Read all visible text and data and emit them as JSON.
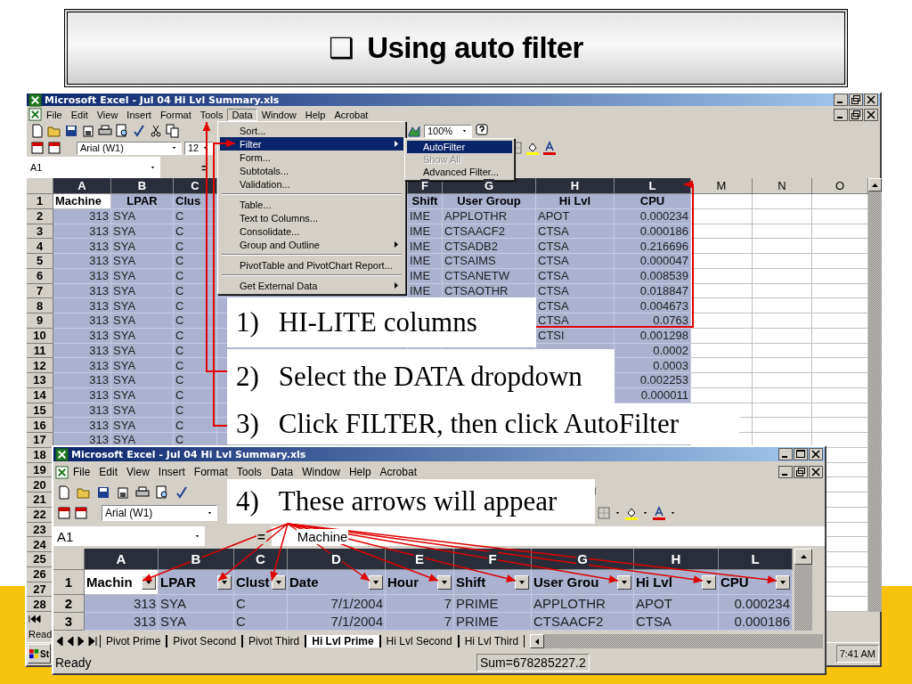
{
  "slide": {
    "bullet": "❑",
    "title": "Using auto filter"
  },
  "back_window": {
    "title": "Microsoft Excel - Jul 04 Hi Lvl Summary.xls",
    "menu": [
      {
        "label": "File",
        "selected": false
      },
      {
        "label": "Edit",
        "selected": false
      },
      {
        "label": "View",
        "selected": false
      },
      {
        "label": "Insert",
        "selected": false
      },
      {
        "label": "Format",
        "selected": false
      },
      {
        "label": "Tools",
        "selected": false
      },
      {
        "label": "Data",
        "selected": true
      },
      {
        "label": "Window",
        "selected": false
      },
      {
        "label": "Help",
        "selected": false
      },
      {
        "label": "Acrobat",
        "selected": false
      }
    ],
    "font": "Arial (W1)",
    "font_size": "12",
    "zoom": "100%",
    "name_box": "A1",
    "formula_sign": "=",
    "columns": [
      {
        "label": "A",
        "selected": true
      },
      {
        "label": "B",
        "selected": true
      },
      {
        "label": "C",
        "selected": true
      },
      {
        "label": "F",
        "selected": true
      },
      {
        "label": "G",
        "selected": true
      },
      {
        "label": "H",
        "selected": true
      },
      {
        "label": "L",
        "selected": true
      },
      {
        "label": "M",
        "selected": false
      },
      {
        "label": "N",
        "selected": false
      },
      {
        "label": "O",
        "selected": false
      }
    ],
    "rows": [
      {
        "num": "1",
        "cells": [
          {
            "kind": "active",
            "text": "Machine"
          },
          {
            "kind": "header",
            "text": "LPAR"
          },
          {
            "kind": "label",
            "text": "Clus"
          },
          {
            "kind": "header",
            "text": "Shift"
          },
          {
            "kind": "header",
            "text": "User Group"
          },
          {
            "kind": "header",
            "text": "Hi Lvl"
          },
          {
            "kind": "header",
            "text": "CPU"
          }
        ]
      },
      {
        "num": "2",
        "cells": [
          {
            "kind": "number",
            "text": "313"
          },
          {
            "kind": "text",
            "text": "SYA"
          },
          {
            "kind": "text",
            "text": "C"
          },
          {
            "kind": "text",
            "text": "IME"
          },
          {
            "kind": "text",
            "text": "APPLOTHR"
          },
          {
            "kind": "text",
            "text": "APOT"
          },
          {
            "kind": "number",
            "text": "0.000234"
          }
        ]
      },
      {
        "num": "3",
        "cells": [
          {
            "kind": "number",
            "text": "313"
          },
          {
            "kind": "text",
            "text": "SYA"
          },
          {
            "kind": "text",
            "text": "C"
          },
          {
            "kind": "text",
            "text": "IME"
          },
          {
            "kind": "text",
            "text": "CTSAACF2"
          },
          {
            "kind": "text",
            "text": "CTSA"
          },
          {
            "kind": "number",
            "text": "0.000186"
          }
        ]
      },
      {
        "num": "4",
        "cells": [
          {
            "kind": "number",
            "text": "313"
          },
          {
            "kind": "text",
            "text": "SYA"
          },
          {
            "kind": "text",
            "text": "C"
          },
          {
            "kind": "text",
            "text": "IME"
          },
          {
            "kind": "text",
            "text": "CTSADB2"
          },
          {
            "kind": "text",
            "text": "CTSA"
          },
          {
            "kind": "number",
            "text": "0.216696"
          }
        ]
      },
      {
        "num": "5",
        "cells": [
          {
            "kind": "number",
            "text": "313"
          },
          {
            "kind": "text",
            "text": "SYA"
          },
          {
            "kind": "text",
            "text": "C"
          },
          {
            "kind": "text",
            "text": "IME"
          },
          {
            "kind": "text",
            "text": "CTSAIMS"
          },
          {
            "kind": "text",
            "text": "CTSA"
          },
          {
            "kind": "number",
            "text": "0.000047"
          }
        ]
      },
      {
        "num": "6",
        "cells": [
          {
            "kind": "number",
            "text": "313"
          },
          {
            "kind": "text",
            "text": "SYA"
          },
          {
            "kind": "text",
            "text": "C"
          },
          {
            "kind": "text",
            "text": "IME"
          },
          {
            "kind": "text",
            "text": "CTSANETW"
          },
          {
            "kind": "text",
            "text": "CTSA"
          },
          {
            "kind": "number",
            "text": "0.008539"
          }
        ]
      },
      {
        "num": "7",
        "cells": [
          {
            "kind": "number",
            "text": "313"
          },
          {
            "kind": "text",
            "text": "SYA"
          },
          {
            "kind": "text",
            "text": "C"
          },
          {
            "kind": "text",
            "text": "IME"
          },
          {
            "kind": "text",
            "text": "CTSAOTHR"
          },
          {
            "kind": "text",
            "text": "CTSA"
          },
          {
            "kind": "number",
            "text": "0.018847"
          }
        ]
      },
      {
        "num": "8",
        "cells": [
          {
            "kind": "number",
            "text": "313"
          },
          {
            "kind": "text",
            "text": "SYA"
          },
          {
            "kind": "text",
            "text": "C"
          },
          {
            "kind": "blank"
          },
          {
            "kind": "blank"
          },
          {
            "kind": "text",
            "text": "CTSA"
          },
          {
            "kind": "number",
            "text": "0.004673"
          }
        ]
      },
      {
        "num": "9",
        "cells": [
          {
            "kind": "number",
            "text": "313"
          },
          {
            "kind": "text",
            "text": "SYA"
          },
          {
            "kind": "text",
            "text": "C"
          },
          {
            "kind": "blank"
          },
          {
            "kind": "blank"
          },
          {
            "kind": "text",
            "text": "CTSA"
          },
          {
            "kind": "number",
            "text": "0.0763"
          }
        ]
      },
      {
        "num": "10",
        "cells": [
          {
            "kind": "number",
            "text": "313"
          },
          {
            "kind": "text",
            "text": "SYA"
          },
          {
            "kind": "text",
            "text": "C"
          },
          {
            "kind": "blank"
          },
          {
            "kind": "blank"
          },
          {
            "kind": "text",
            "text": "CTSI"
          },
          {
            "kind": "number",
            "text": "0.001298"
          }
        ]
      },
      {
        "num": "11",
        "cells": [
          {
            "kind": "number",
            "text": "313"
          },
          {
            "kind": "text",
            "text": "SYA"
          },
          {
            "kind": "text",
            "text": "C"
          },
          {
            "kind": "blank"
          },
          {
            "kind": "blank"
          },
          {
            "kind": "blank"
          },
          {
            "kind": "number",
            "text": "0.0002"
          }
        ]
      },
      {
        "num": "12",
        "cells": [
          {
            "kind": "number",
            "text": "313"
          },
          {
            "kind": "text",
            "text": "SYA"
          },
          {
            "kind": "text",
            "text": "C"
          },
          {
            "kind": "blank"
          },
          {
            "kind": "blank"
          },
          {
            "kind": "blank"
          },
          {
            "kind": "number",
            "text": "0.0003"
          }
        ]
      },
      {
        "num": "13",
        "cells": [
          {
            "kind": "number",
            "text": "313"
          },
          {
            "kind": "text",
            "text": "SYA"
          },
          {
            "kind": "text",
            "text": "C"
          },
          {
            "kind": "blank"
          },
          {
            "kind": "blank"
          },
          {
            "kind": "blank"
          },
          {
            "kind": "number",
            "text": "0.002253"
          }
        ]
      },
      {
        "num": "14",
        "cells": [
          {
            "kind": "number",
            "text": "313"
          },
          {
            "kind": "text",
            "text": "SYA"
          },
          {
            "kind": "text",
            "text": "C"
          },
          {
            "kind": "blank"
          },
          {
            "kind": "blank"
          },
          {
            "kind": "blank"
          },
          {
            "kind": "number",
            "text": "0.000011"
          }
        ]
      },
      {
        "num": "15",
        "cells": [
          {
            "kind": "number",
            "text": "313"
          },
          {
            "kind": "text",
            "text": "SYA"
          },
          {
            "kind": "text",
            "text": "C"
          },
          {
            "kind": "blank"
          },
          {
            "kind": "blank"
          },
          {
            "kind": "blank"
          },
          {
            "kind": "blank"
          }
        ]
      },
      {
        "num": "16",
        "cells": [
          {
            "kind": "number",
            "text": "313"
          },
          {
            "kind": "text",
            "text": "SYA"
          },
          {
            "kind": "text",
            "text": "C"
          },
          {
            "kind": "blank"
          },
          {
            "kind": "blank"
          },
          {
            "kind": "blank"
          },
          {
            "kind": "blank"
          }
        ]
      },
      {
        "num": "17",
        "cells": [
          {
            "kind": "number",
            "text": "313"
          },
          {
            "kind": "text",
            "text": "SYA"
          },
          {
            "kind": "text",
            "text": "C"
          },
          {
            "kind": "blank"
          },
          {
            "kind": "blank"
          },
          {
            "kind": "blank"
          },
          {
            "kind": "blank"
          }
        ]
      },
      {
        "num": "18"
      },
      {
        "num": "19"
      },
      {
        "num": "20"
      },
      {
        "num": "21"
      },
      {
        "num": "22"
      },
      {
        "num": "23"
      },
      {
        "num": "24"
      },
      {
        "num": "25"
      },
      {
        "num": "26"
      },
      {
        "num": "27"
      },
      {
        "num": "28"
      }
    ],
    "status": "Read",
    "start": "St",
    "clock": "7:41 AM"
  },
  "data_menu": {
    "items": [
      {
        "kind": "item",
        "label": "Sort...",
        "selected": false,
        "submenu": false
      },
      {
        "kind": "item",
        "label": "Filter",
        "selected": true,
        "submenu": true
      },
      {
        "kind": "item",
        "label": "Form...",
        "selected": false,
        "submenu": false
      },
      {
        "kind": "item",
        "label": "Subtotals...",
        "selected": false,
        "submenu": false
      },
      {
        "kind": "item",
        "label": "Validation...",
        "selected": false,
        "submenu": false
      },
      {
        "kind": "separator"
      },
      {
        "kind": "item",
        "label": "Table...",
        "selected": false,
        "submenu": false
      },
      {
        "kind": "item",
        "label": "Text to Columns...",
        "selected": false,
        "submenu": false
      },
      {
        "kind": "item",
        "label": "Consolidate...",
        "selected": false,
        "submenu": false
      },
      {
        "kind": "item",
        "label": "Group and Outline",
        "selected": false,
        "submenu": true
      },
      {
        "kind": "separator"
      },
      {
        "kind": "item",
        "label": "PivotTable and PivotChart Report...",
        "selected": false,
        "submenu": false
      },
      {
        "kind": "separator"
      },
      {
        "kind": "item",
        "label": "Get External Data",
        "selected": false,
        "submenu": true
      }
    ]
  },
  "filter_submenu": {
    "items": [
      {
        "label": "AutoFilter",
        "selected": true,
        "disabled": false
      },
      {
        "label": "Show All",
        "selected": false,
        "disabled": true
      },
      {
        "label": "Advanced Filter...",
        "selected": false,
        "disabled": false
      }
    ]
  },
  "callouts": [
    {
      "num": "1)",
      "text": "HI-LITE columns"
    },
    {
      "num": "2)",
      "text": "Select the DATA dropdown"
    },
    {
      "num": "3)",
      "text": "Click FILTER, then click AutoFilter"
    },
    {
      "num": "4)",
      "text": "These arrows will appear"
    }
  ],
  "front_window": {
    "title": "Microsoft Excel - Jul 04 Hi Lvl Summary.xls",
    "menu": [
      {
        "label": "File",
        "selected": false
      },
      {
        "label": "Edit",
        "selected": false
      },
      {
        "label": "View",
        "selected": false
      },
      {
        "label": "Insert",
        "selected": false
      },
      {
        "label": "Format",
        "selected": false
      },
      {
        "label": "Tools",
        "selected": false
      },
      {
        "label": "Data",
        "selected": false
      },
      {
        "label": "Window",
        "selected": false
      },
      {
        "label": "Help",
        "selected": false
      },
      {
        "label": "Acrobat",
        "selected": false
      }
    ],
    "font": "Arial (W1)",
    "name_box": "A1",
    "formula_sign": "=",
    "formula": "Machine",
    "autofilter": true,
    "columns": [
      {
        "label": "A",
        "selected": true
      },
      {
        "label": "B",
        "selected": true
      },
      {
        "label": "C",
        "selected": true
      },
      {
        "label": "D",
        "selected": true
      },
      {
        "label": "E",
        "selected": true
      },
      {
        "label": "F",
        "selected": true
      },
      {
        "label": "G",
        "selected": true
      },
      {
        "label": "H",
        "selected": true
      },
      {
        "label": "L",
        "selected": true
      }
    ],
    "rows": [
      {
        "num": "1",
        "cells": [
          {
            "kind": "active",
            "text": "Machin"
          },
          {
            "kind": "header",
            "text": "LPAR"
          },
          {
            "kind": "header",
            "text": "Clust"
          },
          {
            "kind": "header",
            "text": "Date"
          },
          {
            "kind": "header",
            "text": "Hour"
          },
          {
            "kind": "header",
            "text": "Shift"
          },
          {
            "kind": "header",
            "text": "User Grou"
          },
          {
            "kind": "header",
            "text": "Hi Lvl"
          },
          {
            "kind": "header",
            "text": "CPU"
          }
        ]
      },
      {
        "num": "2",
        "cells": [
          {
            "kind": "number",
            "text": "313"
          },
          {
            "kind": "text",
            "text": "SYA"
          },
          {
            "kind": "text",
            "text": "C"
          },
          {
            "kind": "number",
            "text": "7/1/2004"
          },
          {
            "kind": "number",
            "text": "7"
          },
          {
            "kind": "text",
            "text": "PRIME"
          },
          {
            "kind": "text",
            "text": "APPLOTHR"
          },
          {
            "kind": "text",
            "text": "APOT"
          },
          {
            "kind": "number",
            "text": "0.000234"
          }
        ]
      },
      {
        "num": "3",
        "cells": [
          {
            "kind": "number",
            "text": "313"
          },
          {
            "kind": "text",
            "text": "SYA"
          },
          {
            "kind": "text",
            "text": "C"
          },
          {
            "kind": "number",
            "text": "7/1/2004"
          },
          {
            "kind": "number",
            "text": "7"
          },
          {
            "kind": "text",
            "text": "PRIME"
          },
          {
            "kind": "text",
            "text": "CTSAACF2"
          },
          {
            "kind": "text",
            "text": "CTSA"
          },
          {
            "kind": "number",
            "text": "0.000186"
          }
        ]
      }
    ],
    "sheet_tabs": [
      {
        "label": "Pivot Prime",
        "selected": false
      },
      {
        "label": "Pivot Second",
        "selected": false
      },
      {
        "label": "Pivot Third",
        "selected": false
      },
      {
        "label": "Hi Lvl Prime",
        "selected": true
      },
      {
        "label": "Hi Lvl Second",
        "selected": false
      },
      {
        "label": "Hi Lvl Third",
        "selected": false
      }
    ],
    "status": "Ready",
    "sum": "Sum=678285227.2"
  }
}
